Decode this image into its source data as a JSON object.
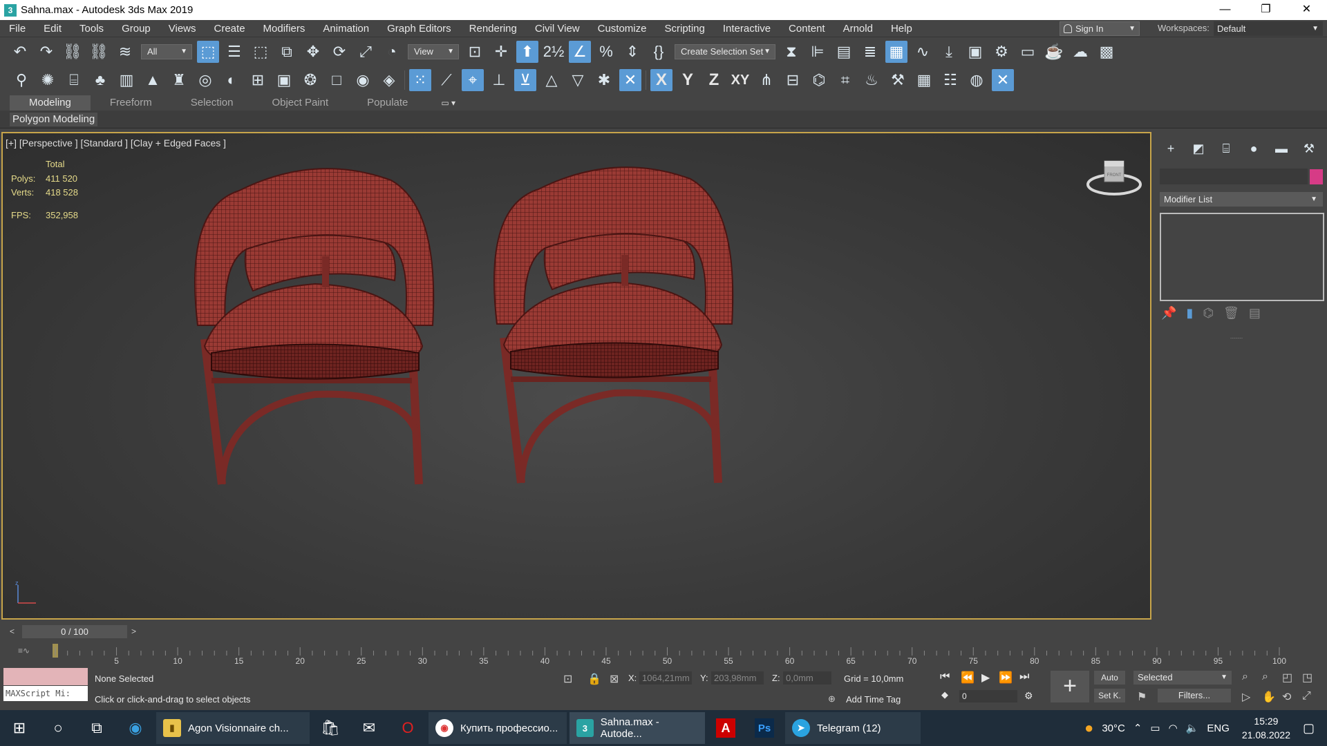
{
  "window": {
    "title": "Sahna.max - Autodesk 3ds Max 2019",
    "app_icon_text": "3",
    "minimize": "—",
    "restore": "❐",
    "close": "✕"
  },
  "menu": [
    "File",
    "Edit",
    "Tools",
    "Group",
    "Views",
    "Create",
    "Modifiers",
    "Animation",
    "Graph Editors",
    "Rendering",
    "Civil View",
    "Customize",
    "Scripting",
    "Interactive",
    "Content",
    "Arnold",
    "Help"
  ],
  "sign_in": "Sign In",
  "workspaces_label": "Workspaces:",
  "workspaces_value": "Default",
  "toolbar1": {
    "filter_value": "All",
    "refcoord_value": "View",
    "selection_set": "Create Selection Set"
  },
  "toolbar2": {
    "axis_x": "X",
    "axis_y": "Y",
    "axis_z": "Z",
    "axis_xy": "XY"
  },
  "ribbon": {
    "tabs": [
      "Modeling",
      "Freeform",
      "Selection",
      "Object Paint",
      "Populate"
    ],
    "active_tab": "Modeling",
    "panel": "Polygon Modeling"
  },
  "viewport": {
    "label": "[+] [Perspective ] [Standard ] [Clay + Edged Faces ]",
    "stats_header": "Total",
    "polys_label": "Polys:",
    "polys_value": "411 520",
    "verts_label": "Verts:",
    "verts_value": "418 528",
    "fps_label": "FPS:",
    "fps_value": "352,958",
    "viewcube_face": "FRONT"
  },
  "command_panel": {
    "modifier_list": "Modifier List",
    "object_color": "#d63b86"
  },
  "time_slider": {
    "value": "0 / 100",
    "ticks": [
      "5",
      "10",
      "15",
      "20",
      "25",
      "30",
      "35",
      "40",
      "45",
      "50",
      "55",
      "60",
      "65",
      "70",
      "75",
      "80",
      "85",
      "90",
      "95",
      "100"
    ]
  },
  "status": {
    "selection": "None Selected",
    "prompt": "Click or click-and-drag to select objects",
    "maxscript": "MAXScript Mi:",
    "x_label": "X:",
    "x_value": "1064,21mm",
    "y_label": "Y:",
    "y_value": "203,98mm",
    "z_label": "Z:",
    "z_value": "0,0mm",
    "grid": "Grid = 10,0mm",
    "add_time_tag": "Add Time Tag",
    "frame_value": "0",
    "auto": "Auto",
    "set_key": "Set K.",
    "key_filter": "Selected",
    "filters": "Filters..."
  },
  "taskbar": {
    "apps": [
      {
        "label": "Agon Visionnaire ch...",
        "icon": "folder-icon"
      },
      {
        "label": "Купить профессио...",
        "icon": "chrome-icon"
      },
      {
        "label": "Sahna.max - Autode...",
        "icon": "3dsmax-icon"
      },
      {
        "label": "Telegram (12)",
        "icon": "telegram-icon"
      }
    ],
    "temperature": "30°C",
    "language": "ENG",
    "time": "15:29",
    "date": "21.08.2022"
  }
}
